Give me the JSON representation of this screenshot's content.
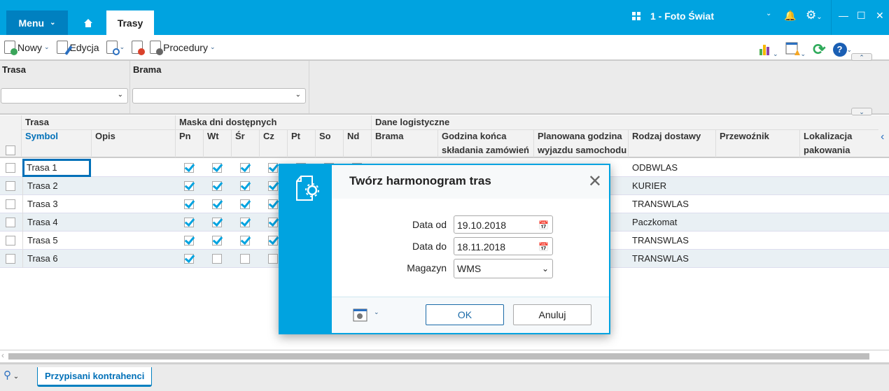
{
  "topbar": {
    "menu": "Menu",
    "tab": "Trasy",
    "company": "1 - Foto Świat"
  },
  "toolbar": {
    "new": "Nowy",
    "edit": "Edycja",
    "procedures": "Procedury"
  },
  "filters": {
    "trasa_label": "Trasa",
    "brama_label": "Brama",
    "trasa_value": "",
    "brama_value": ""
  },
  "grid": {
    "groups": [
      "Trasa",
      "Maska dni dostępnych",
      "Dane logistyczne"
    ],
    "columns": [
      "Symbol",
      "Opis",
      "Pn",
      "Wt",
      "Śr",
      "Cz",
      "Pt",
      "So",
      "Nd",
      "Brama",
      "Godzina końca składania zamówień",
      "Planowana godzina wyjazdu samochodu",
      "Rodzaj dostawy",
      "Przewoźnik",
      "Lokalizacja pakowania"
    ],
    "rows": [
      {
        "symbol": "Trasa 1",
        "days": [
          true,
          true,
          true,
          true,
          true,
          true,
          true
        ],
        "rodzaj": "ODBWLAS"
      },
      {
        "symbol": "Trasa 2",
        "days": [
          true,
          true,
          true,
          true,
          true,
          true,
          true
        ],
        "rodzaj": "KURIER"
      },
      {
        "symbol": "Trasa 3",
        "days": [
          true,
          true,
          true,
          true,
          true,
          true,
          true
        ],
        "rodzaj": "TRANSWLAS"
      },
      {
        "symbol": "Trasa 4",
        "days": [
          true,
          true,
          true,
          true,
          true,
          true,
          true
        ],
        "rodzaj": "Paczkomat"
      },
      {
        "symbol": "Trasa 5",
        "days": [
          true,
          true,
          true,
          true,
          true,
          true,
          true
        ],
        "rodzaj": "TRANSWLAS"
      },
      {
        "symbol": "Trasa 6",
        "days": [
          true,
          false,
          false,
          false,
          false,
          false,
          false
        ],
        "rodzaj": "TRANSWLAS"
      }
    ]
  },
  "bottom": {
    "tab": "Przypisani kontrahenci"
  },
  "dialog": {
    "title": "Twórz harmonogram tras",
    "date_from_label": "Data od",
    "date_from": "19.10.2018",
    "date_to_label": "Data do",
    "date_to": "18.11.2018",
    "warehouse_label": "Magazyn",
    "warehouse": "WMS",
    "ok": "OK",
    "cancel": "Anuluj"
  }
}
